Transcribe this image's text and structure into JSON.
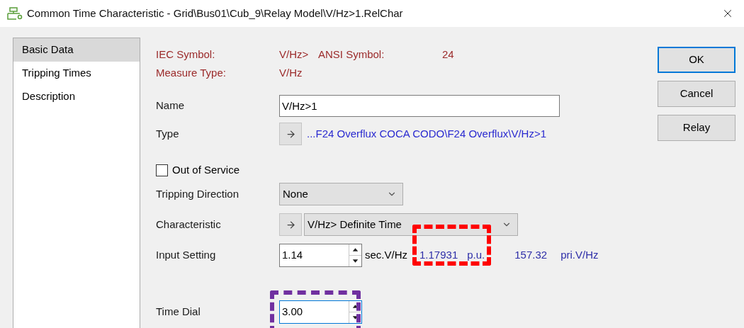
{
  "window": {
    "title": "Common Time Characteristic - Grid\\Bus01\\Cub_9\\Relay Model\\V/Hz>1.RelChar"
  },
  "sidebar": {
    "items": [
      {
        "label": "Basic Data",
        "selected": true
      },
      {
        "label": "Tripping Times",
        "selected": false
      },
      {
        "label": "Description",
        "selected": false
      }
    ]
  },
  "symbols": {
    "iec_label": "IEC Symbol:",
    "iec_value": "V/Hz>",
    "ansi_label": "ANSI Symbol:",
    "ansi_value": "24",
    "measure_label": "Measure Type:",
    "measure_value": "V/Hz"
  },
  "name": {
    "label": "Name",
    "value": "V/Hz>1"
  },
  "type": {
    "label": "Type",
    "link": "...F24 Overflux COCA CODO\\F24 Overflux\\V/Hz>1"
  },
  "out_of_service": {
    "label": "Out of Service",
    "checked": false
  },
  "tripping_direction": {
    "label": "Tripping Direction",
    "value": "None"
  },
  "characteristic": {
    "label": "Characteristic",
    "value": "V/Hz> Definite Time"
  },
  "input_setting": {
    "label": "Input Setting",
    "value": "1.14",
    "unit": "sec.V/Hz",
    "pu_value": "1.17931",
    "pu_unit": "p.u.",
    "primary_value": "157.32",
    "primary_unit": "pri.V/Hz",
    "highlight": {
      "color": "#ff0000"
    }
  },
  "time_dial": {
    "label": "Time Dial",
    "value": "3.00",
    "focused": true,
    "highlight": {
      "color": "#7030a0"
    }
  },
  "buttons": [
    {
      "label": "OK",
      "default": true
    },
    {
      "label": "Cancel",
      "default": false
    },
    {
      "label": "Relay",
      "default": false
    }
  ]
}
